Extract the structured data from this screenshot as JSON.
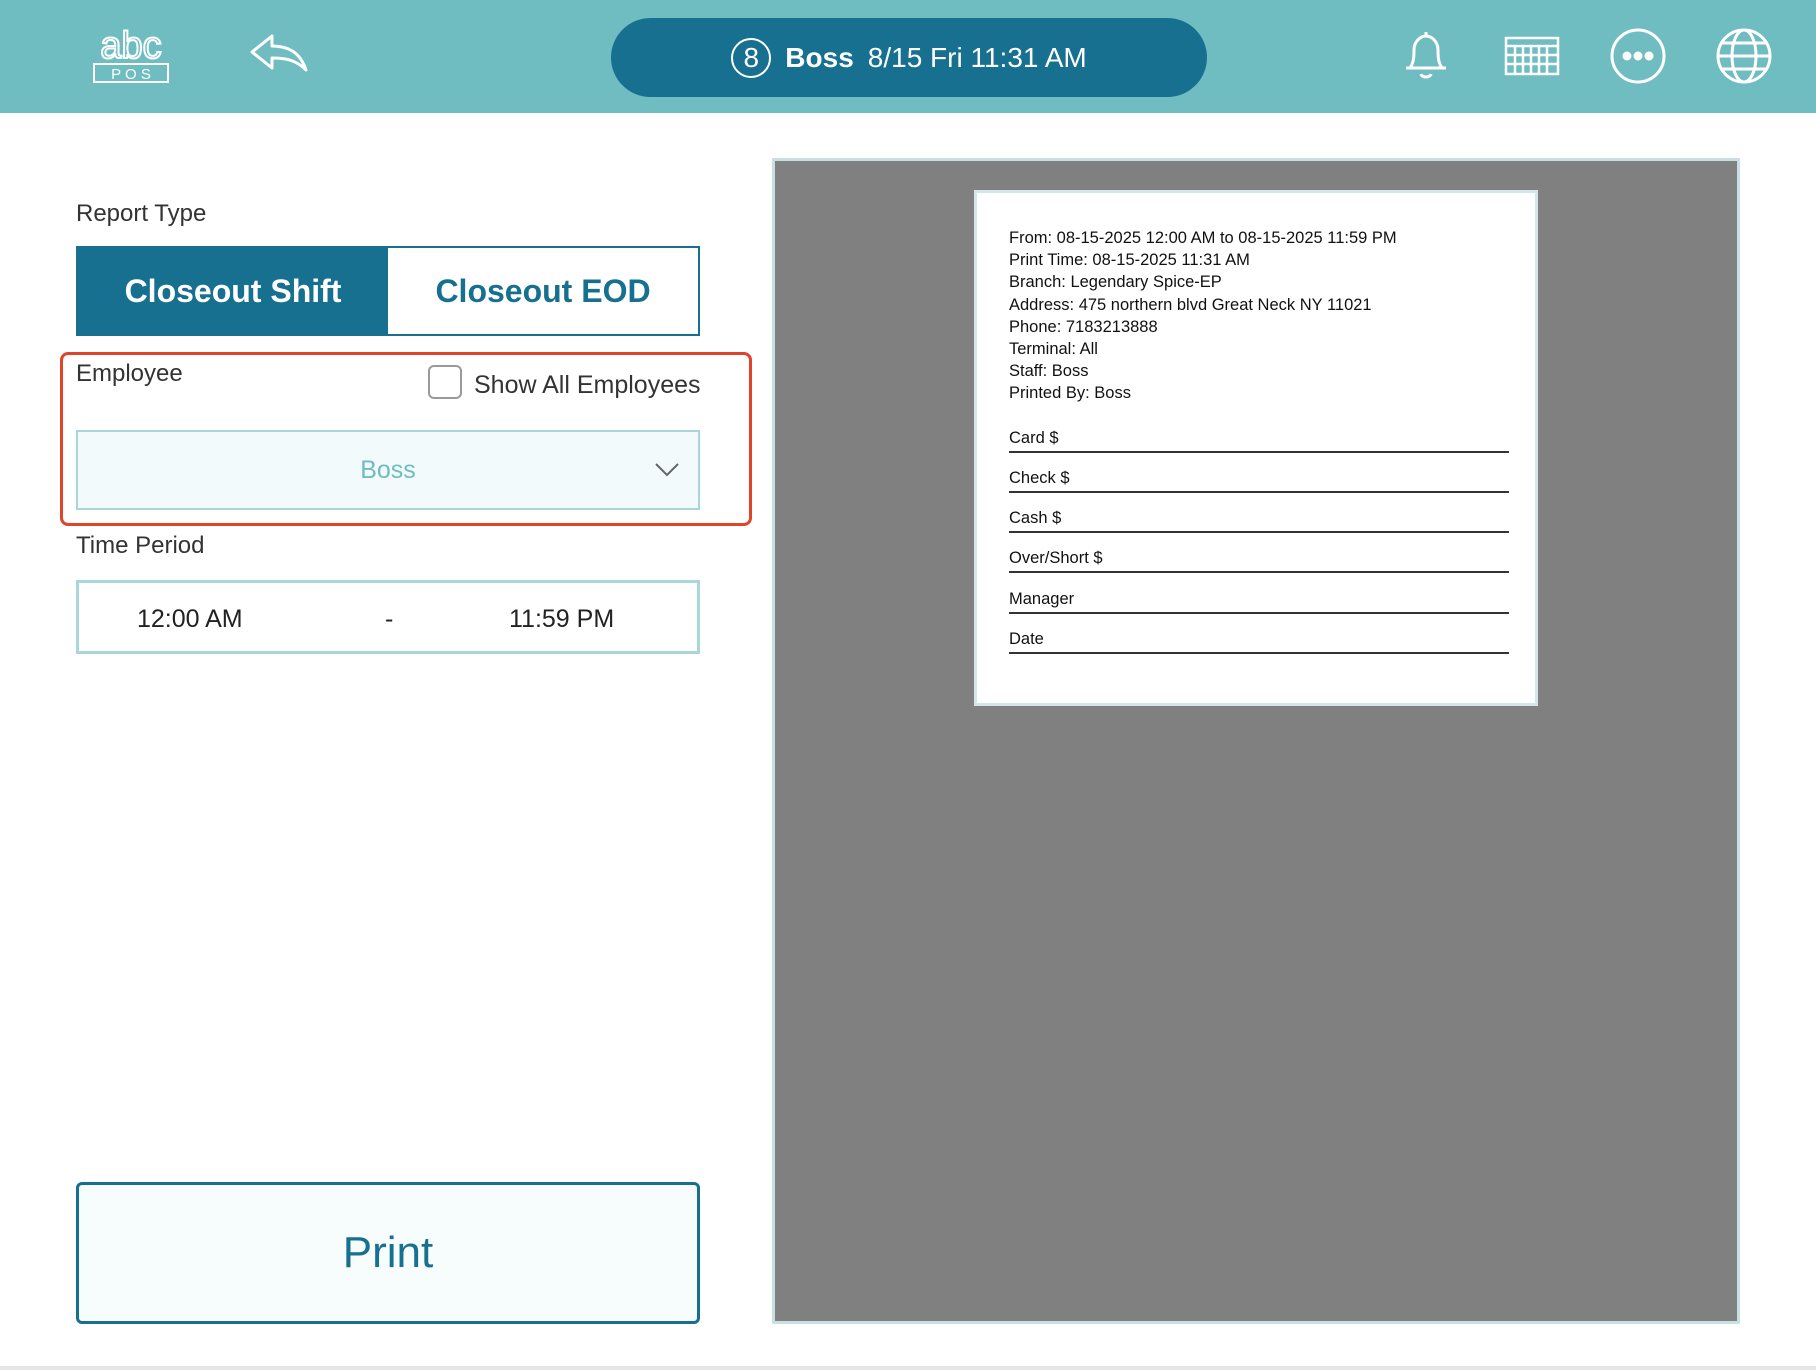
{
  "header": {
    "logo_letters": "abc",
    "logo_sub": "P O S",
    "station_number": "8",
    "user": "Boss",
    "datetime": "8/15 Fri 11:31 AM",
    "icons": [
      "back-icon",
      "bell-icon",
      "calendar-icon",
      "more-icon",
      "globe-icon"
    ]
  },
  "report_type": {
    "label": "Report Type",
    "options": [
      "Closeout Shift",
      "Closeout EOD"
    ],
    "selected": "Closeout Shift"
  },
  "employee": {
    "label": "Employee",
    "show_all_label": "Show All Employees",
    "show_all_checked": false,
    "selected": "Boss"
  },
  "time_period": {
    "label": "Time Period",
    "start": "12:00 AM",
    "separator": "-",
    "end": "11:59 PM"
  },
  "print_label": "Print",
  "receipt": {
    "lines": [
      "From: 08-15-2025 12:00 AM to 08-15-2025 11:59 PM",
      "Print Time: 08-15-2025 11:31 AM",
      "Branch: Legendary Spice-EP",
      "Address: 475 northern blvd  Great Neck NY 11021",
      "Phone: 7183213888",
      "Terminal: All",
      "Staff: Boss",
      "Printed By: Boss"
    ],
    "fields": [
      "Card $",
      "Check $",
      "Cash $",
      "Over/Short $",
      "Manager",
      "Date"
    ]
  },
  "colors": {
    "topbar": "#6fbdc1",
    "primary": "#17708f",
    "highlight": "#e0442b",
    "preview_bg": "#808080"
  }
}
